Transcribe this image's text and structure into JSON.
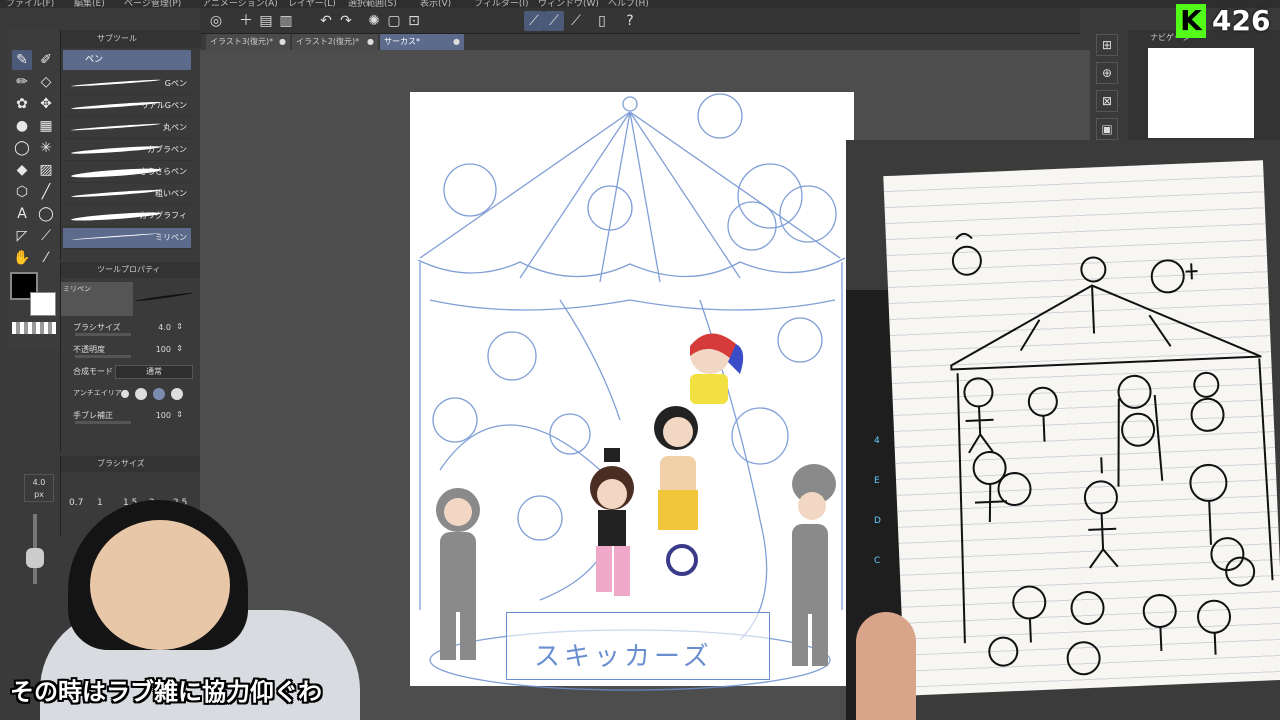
{
  "menubar": {
    "items": [
      "ファイル(F)",
      "編集(E)",
      "ページ管理(P)",
      "アニメーション(A)",
      "レイヤー(L)",
      "選択範囲(S)",
      "表示(V)",
      "フィルター(I)",
      "ウィンドウ(W)",
      "ヘルプ(H)"
    ]
  },
  "tabs": [
    {
      "label": "イラスト3(復元)*"
    },
    {
      "label": "イラスト2(復元)*"
    },
    {
      "label": "サーカス*"
    }
  ],
  "subtool": {
    "header": "サブツール",
    "group": "ペン",
    "brushes": [
      "Gペン",
      "リアルGペン",
      "丸ペン",
      "カブラペン",
      "さらさらペン",
      "粗いペン",
      "カリグラフィ",
      "ミリペン"
    ]
  },
  "toolprop": {
    "header": "ツールプロパティ",
    "preset_name": "ミリペン",
    "brush_size_label": "ブラシサイズ",
    "brush_size_value": "4.0",
    "opacity_label": "不透明度",
    "opacity_value": "100",
    "blend_label": "合成モード",
    "blend_value": "通常",
    "aa_label": "アンチエイリアス",
    "stabilize_label": "手ブレ補正",
    "stabilize_value": "100"
  },
  "brushsize_palette": {
    "header": "ブラシサイズ",
    "values": [
      "0.7",
      "1",
      "1.5",
      "2",
      "2.5"
    ]
  },
  "size_readout": {
    "value": "4.0",
    "unit": "px"
  },
  "canvas": {
    "banner_text": "スキッカーズ"
  },
  "navigator": {
    "label": "ナビゲーター"
  },
  "stream": {
    "platform_logo": "K",
    "viewer_count": "426",
    "subtitle": "その時はラブ雑に協力仰ぐわ"
  },
  "keyboard": {
    "keys": [
      "4",
      "E",
      "D",
      "C"
    ]
  },
  "colors": {
    "accent": "#5c6a8c",
    "kick_green": "#53fc18",
    "sketch_blue": "#6a8fd0"
  }
}
